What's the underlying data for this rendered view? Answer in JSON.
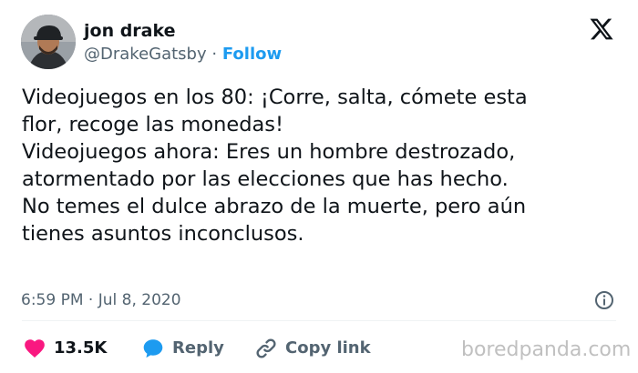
{
  "author": {
    "display_name": "jon drake",
    "handle": "@DrakeGatsby",
    "separator": "·",
    "follow_label": "Follow"
  },
  "brand": {
    "icon": "x-logo-icon"
  },
  "tweet": {
    "lines": [
      "Videojuegos en los 80: ¡Corre, salta, cómete esta",
      "flor, recoge las monedas!",
      "Videojuegos ahora: Eres un hombre destrozado,",
      "atormentado por las elecciones que has hecho.",
      "No temes el dulce abrazo de la muerte, pero aún",
      "tienes asuntos inconclusos."
    ]
  },
  "meta": {
    "time": "6:59 PM",
    "separator": "·",
    "date": "Jul 8, 2020",
    "info_icon": "info-circle-icon"
  },
  "actions": {
    "like": {
      "icon": "heart-icon",
      "label": "13.5K",
      "color": "#f91880"
    },
    "reply": {
      "icon": "speech-bubble-icon",
      "label": "Reply",
      "color": "#1d9bf0"
    },
    "copy": {
      "icon": "link-icon",
      "label": "Copy link"
    }
  },
  "watermark": "boredpanda.com",
  "colors": {
    "text": "#0f1419",
    "secondary": "#536471",
    "accent": "#1d9bf0",
    "like": "#f91880",
    "watermark": "#c0c0c0"
  }
}
